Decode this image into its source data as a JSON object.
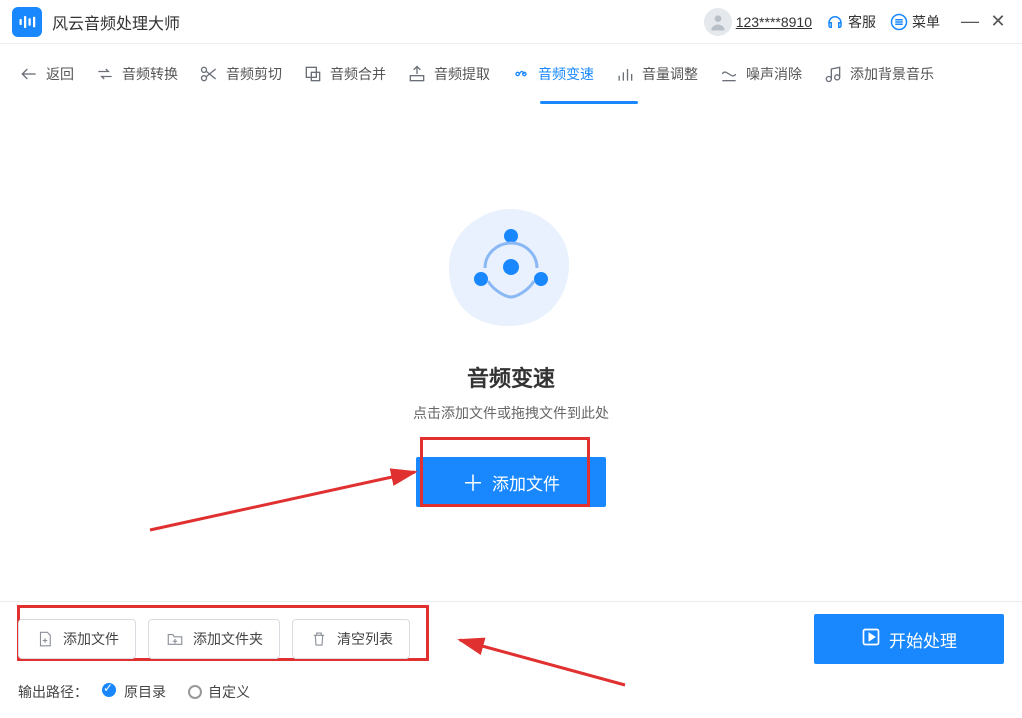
{
  "app": {
    "title": "风云音频处理大师"
  },
  "titlebar": {
    "user_id": "123****8910",
    "support_label": "客服",
    "menu_label": "菜单"
  },
  "toolbar": {
    "back": "返回",
    "items": [
      {
        "label": "音频转换"
      },
      {
        "label": "音频剪切"
      },
      {
        "label": "音频合并"
      },
      {
        "label": "音频提取"
      },
      {
        "label": "音频变速"
      },
      {
        "label": "音量调整"
      },
      {
        "label": "噪声消除"
      },
      {
        "label": "添加背景音乐"
      }
    ],
    "active_index": 4
  },
  "main": {
    "heading": "音频变速",
    "subtext": "点击添加文件或拖拽文件到此处",
    "add_button": "添加文件"
  },
  "bottom": {
    "buttons": {
      "add_file": "添加文件",
      "add_folder": "添加文件夹",
      "clear_list": "清空列表"
    },
    "start_button": "开始处理",
    "output_label": "输出路径：",
    "radio_original": "原目录",
    "radio_custom": "自定义",
    "radio_selected": "original"
  }
}
